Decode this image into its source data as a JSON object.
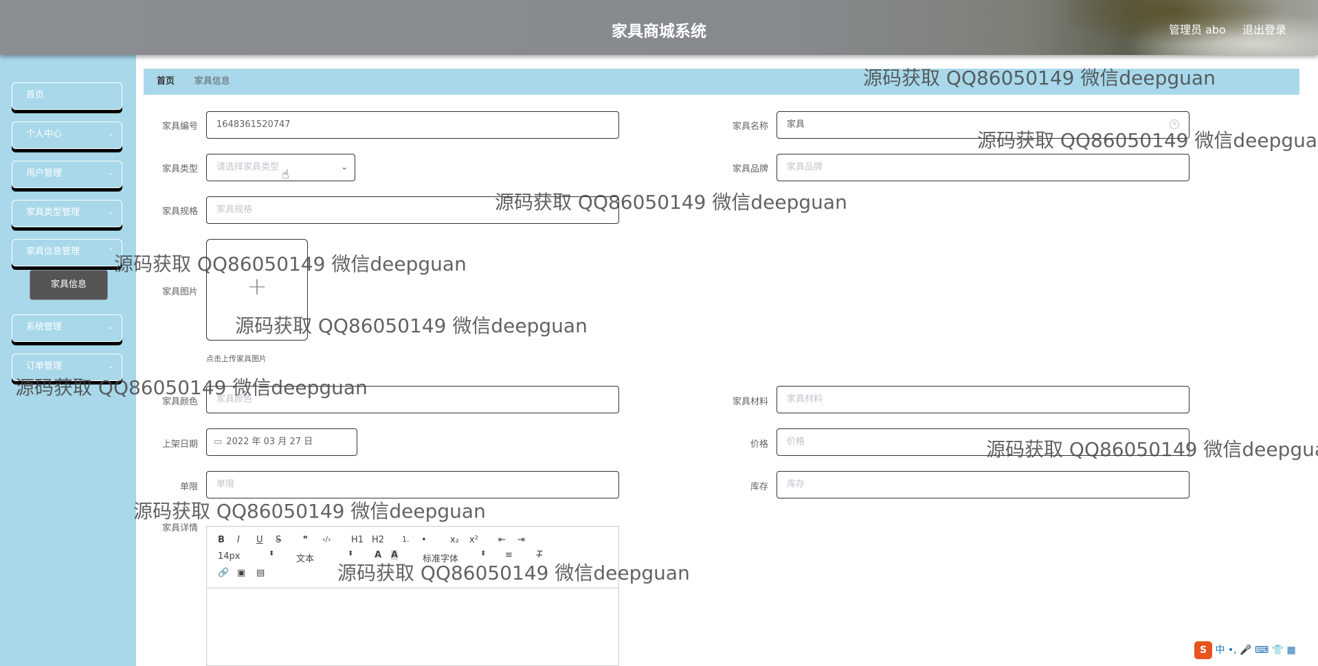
{
  "header": {
    "title": "家具商城系统",
    "user": "管理员 abo",
    "logout": "退出登录"
  },
  "sidebar": {
    "items": [
      {
        "label": "首页"
      },
      {
        "label": "个人中心"
      },
      {
        "label": "用户管理"
      },
      {
        "label": "家具类型管理"
      },
      {
        "label": "家具信息管理"
      },
      {
        "label": "系统管理"
      },
      {
        "label": "订单管理"
      }
    ],
    "active_sub": "家具信息"
  },
  "breadcrumb": {
    "home": "首页",
    "current": "家具信息"
  },
  "form": {
    "code_label": "家具编号",
    "code_value": "1648361520747",
    "name_label": "家具名称",
    "name_value": "家具",
    "type_label": "家具类型",
    "type_placeholder": "请选择家具类型",
    "brand_label": "家具品牌",
    "brand_placeholder": "家具品牌",
    "spec_label": "家具规格",
    "spec_placeholder": "家具规格",
    "image_label": "家具图片",
    "image_tip": "点击上传家具图片",
    "color_label": "家具颜色",
    "color_placeholder": "家具颜色",
    "material_label": "家具材料",
    "material_placeholder": "家具材料",
    "date_label": "上架日期",
    "date_value": "2022 年 03 月 27 日",
    "price_label": "价格",
    "price_placeholder": "价格",
    "limit_label": "单限",
    "limit_placeholder": "单限",
    "stock_label": "库存",
    "stock_placeholder": "库存",
    "detail_label": "家具详情"
  },
  "editor": {
    "font_size": "14px",
    "paragraph": "文本",
    "font_family": "标准字体",
    "buttons": [
      "B",
      "I",
      "U",
      "S",
      "❞",
      "‹/›",
      "H1",
      "H2",
      "1.",
      "•",
      "x₂",
      "x²",
      "⇤",
      "⇥"
    ]
  },
  "watermark": "源码获取 QQ86050149 微信deepguan",
  "ime": {
    "lang": "中"
  }
}
